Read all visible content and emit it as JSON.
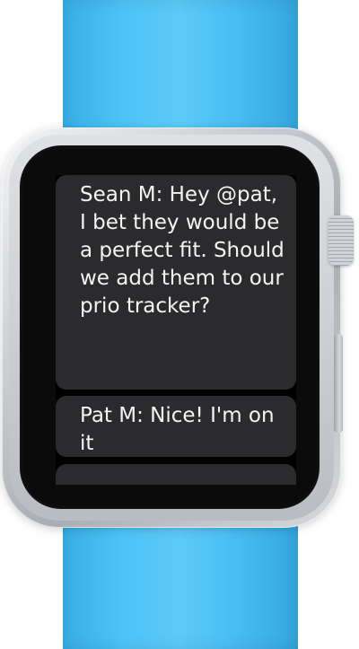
{
  "watch": {
    "band_color": "#4cc3f6",
    "case_color": "#c9ccd0",
    "screen_color": "#000000",
    "bubble_color": "#2b2b2d",
    "text_color": "#f4f4f5"
  },
  "messages": [
    {
      "text": "Sean M: Hey @pat, I bet they would be a perfect fit. Should we add them to our prio tracker?"
    },
    {
      "text": "Pat M: Nice! I'm on it"
    },
    {
      "text": ""
    }
  ]
}
